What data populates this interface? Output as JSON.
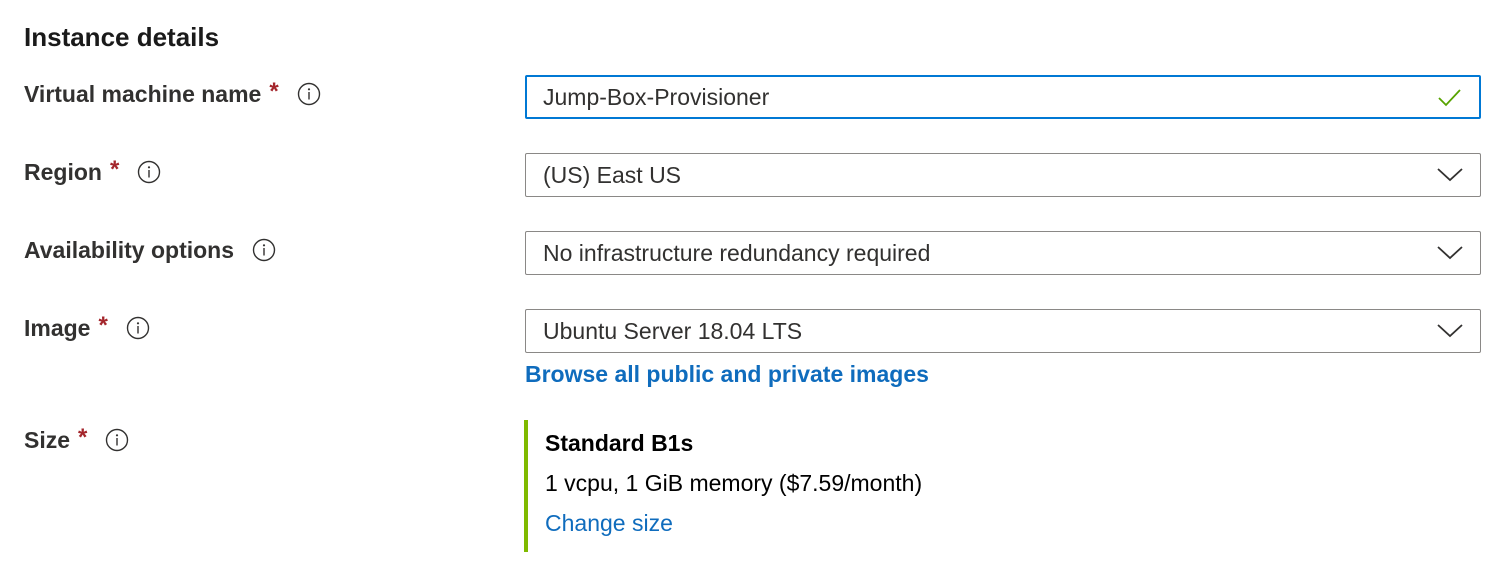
{
  "section": {
    "title": "Instance details"
  },
  "colors": {
    "focus_border": "#0078d4",
    "required_mark": "#a4262c",
    "link": "#0f6cbd",
    "valid_check": "#57a300",
    "size_accent": "#7fba00"
  },
  "fields": {
    "vm_name": {
      "label": "Virtual machine name",
      "required_mark": "*",
      "value": "Jump-Box-Provisioner",
      "status_icon": "check-icon"
    },
    "region": {
      "label": "Region",
      "required_mark": "*",
      "value": "(US) East US"
    },
    "availability": {
      "label": "Availability options",
      "value": "No infrastructure redundancy required"
    },
    "image": {
      "label": "Image",
      "required_mark": "*",
      "value": "Ubuntu Server 18.04 LTS",
      "link": "Browse all public and private images"
    },
    "size": {
      "label": "Size",
      "required_mark": "*",
      "name": "Standard B1s",
      "description": "1 vcpu, 1 GiB memory ($7.59/month)",
      "link": "Change size"
    }
  }
}
